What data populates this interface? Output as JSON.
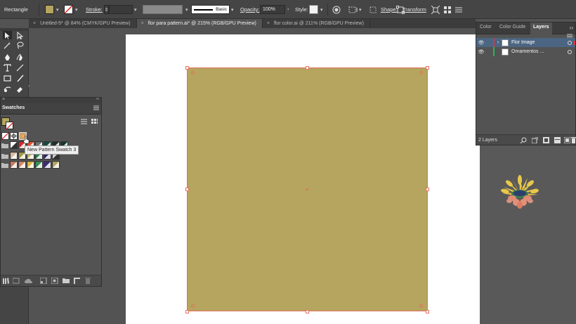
{
  "control_bar": {
    "object_type": "Rectangle",
    "stroke_label": "Stroke:",
    "brush_label": "Basic",
    "opacity_label": "Opacity:",
    "opacity_value": "100%",
    "style_label": "Style:",
    "shape_label": "Shape:",
    "transform_label": "Transform",
    "fill_color": "#b5a55e"
  },
  "tabs": [
    {
      "label": "Untitled-5* @ 84% (CMYK/GPU Preview)",
      "active": false
    },
    {
      "label": "flor para pattern.ai* @ 215% (RGB/GPU Preview)",
      "active": true
    },
    {
      "label": "flor color.ai @ 211% (RGB/GPU Preview)",
      "active": false
    }
  ],
  "swatches_panel": {
    "title": "Swatches",
    "tooltip": "New Pattern Swatch 3",
    "colors": {
      "row1": [
        "#ffffff",
        "#d2292a",
        "#e84a2a",
        "#6f6f6f",
        "#0e4d3d",
        "#1f2f2b",
        "#113a33"
      ],
      "row2": [
        "#d7bb9e",
        "#9f9a45",
        "#c3b464",
        "#2f7d55",
        "#2d2a6c",
        "#cccccc"
      ],
      "row3": [
        "#c07d61",
        "#d38564",
        "#d8b640",
        "#3c8c5a",
        "#3c2c78",
        "#b5a55e"
      ]
    }
  },
  "layers_panel": {
    "tabs": [
      "Color",
      "Color Guide",
      "Layers"
    ],
    "active_tab": "Layers",
    "layers": [
      {
        "name": "Flor Image",
        "color": "#e0323c",
        "selected": true
      },
      {
        "name": "Ornamentos ...",
        "color": "#29b35a",
        "selected": false
      }
    ],
    "count_label": "2 Layers"
  },
  "canvas": {
    "artboard_color": "#ffffff",
    "rect_fill": "#b5a55e",
    "selection_color": "#e0735f"
  }
}
